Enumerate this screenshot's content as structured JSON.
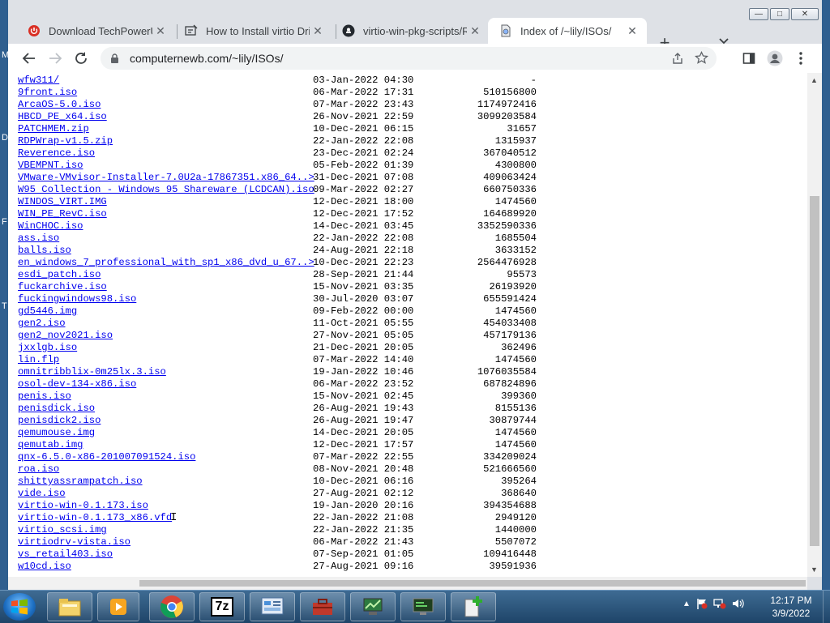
{
  "browser": {
    "tabs": [
      {
        "title": "Download TechPowerUp",
        "icon": "power-icon",
        "active": false
      },
      {
        "title": "How to Install virtio Driv",
        "icon": "site-icon",
        "active": false
      },
      {
        "title": "virtio-win-pkg-scripts/R",
        "icon": "github-icon",
        "active": false
      },
      {
        "title": "Index of /~lily/ISOs/",
        "icon": "file-icon",
        "active": true
      }
    ],
    "close_glyph": "✕",
    "new_tab_glyph": "+",
    "tab_search_glyph": "⌄",
    "url": "computernewb.com/~lily/ISOs/"
  },
  "window_controls": {
    "minimize": "—",
    "maximize": "□",
    "close": "✕"
  },
  "desktop_letters": [
    "M",
    "D",
    "F",
    "T"
  ],
  "listing": [
    {
      "name": "wfw311/",
      "date": "03-Jan-2022 04:30",
      "size": "-"
    },
    {
      "name": "9front.iso",
      "date": "06-Mar-2022 17:31",
      "size": "510156800"
    },
    {
      "name": "ArcaOS-5.0.iso",
      "date": "07-Mar-2022 23:43",
      "size": "1174972416"
    },
    {
      "name": "HBCD_PE_x64.iso",
      "date": "26-Nov-2021 22:59",
      "size": "3099203584"
    },
    {
      "name": "PATCHMEM.zip",
      "date": "10-Dec-2021 06:15",
      "size": "31657"
    },
    {
      "name": "RDPWrap-v1.5.zip",
      "date": "22-Jan-2022 22:08",
      "size": "1315937"
    },
    {
      "name": "Reverence.iso",
      "date": "23-Dec-2021 02:24",
      "size": "367040512"
    },
    {
      "name": "VBEMPNT.iso",
      "date": "05-Feb-2022 01:39",
      "size": "4300800"
    },
    {
      "name": "VMware-VMvisor-Installer-7.0U2a-17867351.x86_64..>",
      "date": "31-Dec-2021 07:08",
      "size": "409063424"
    },
    {
      "name": "W95 Collection - Windows 95 Shareware (LCDCAN).iso",
      "date": "09-Mar-2022 02:27",
      "size": "660750336"
    },
    {
      "name": "WINDOS_VIRT.IMG",
      "date": "12-Dec-2021 18:00",
      "size": "1474560"
    },
    {
      "name": "WIN_PE_RevC.iso",
      "date": "12-Dec-2021 17:52",
      "size": "164689920"
    },
    {
      "name": "WinCHOC.iso",
      "date": "14-Dec-2021 03:45",
      "size": "3352590336"
    },
    {
      "name": "ass.iso",
      "date": "22-Jan-2022 22:08",
      "size": "1685504"
    },
    {
      "name": "balls.iso",
      "date": "24-Aug-2021 22:18",
      "size": "3633152"
    },
    {
      "name": "en_windows_7_professional_with_sp1_x86_dvd_u_67..>",
      "date": "10-Dec-2021 22:23",
      "size": "2564476928"
    },
    {
      "name": "esdi_patch.iso",
      "date": "28-Sep-2021 21:44",
      "size": "95573"
    },
    {
      "name": "fuckarchive.iso",
      "date": "15-Nov-2021 03:35",
      "size": "26193920"
    },
    {
      "name": "fuckingwindows98.iso",
      "date": "30-Jul-2020 03:07",
      "size": "655591424"
    },
    {
      "name": "gd5446.img",
      "date": "09-Feb-2022 00:00",
      "size": "1474560"
    },
    {
      "name": "gen2.iso",
      "date": "11-Oct-2021 05:55",
      "size": "454033408"
    },
    {
      "name": "gen2_nov2021.iso",
      "date": "27-Nov-2021 05:05",
      "size": "457179136"
    },
    {
      "name": "jxxlgb.iso",
      "date": "21-Dec-2021 20:05",
      "size": "362496"
    },
    {
      "name": "lin.flp",
      "date": "07-Mar-2022 14:40",
      "size": "1474560"
    },
    {
      "name": "omnitribblix-0m25lx.3.iso",
      "date": "19-Jan-2022 10:46",
      "size": "1076035584"
    },
    {
      "name": "osol-dev-134-x86.iso",
      "date": "06-Mar-2022 23:52",
      "size": "687824896"
    },
    {
      "name": "penis.iso",
      "date": "15-Nov-2021 02:45",
      "size": "399360"
    },
    {
      "name": "penisdick.iso",
      "date": "26-Aug-2021 19:43",
      "size": "8155136"
    },
    {
      "name": "penisdick2.iso",
      "date": "26-Aug-2021 19:47",
      "size": "30879744"
    },
    {
      "name": "qemumouse.img",
      "date": "14-Dec-2021 20:05",
      "size": "1474560"
    },
    {
      "name": "qemutab.img",
      "date": "12-Dec-2021 17:57",
      "size": "1474560"
    },
    {
      "name": "qnx-6.5.0-x86-201007091524.iso",
      "date": "07-Mar-2022 22:55",
      "size": "334209024"
    },
    {
      "name": "roa.iso",
      "date": "08-Nov-2021 20:48",
      "size": "521666560"
    },
    {
      "name": "shittyassrampatch.iso",
      "date": "10-Dec-2021 06:16",
      "size": "395264"
    },
    {
      "name": "vide.iso",
      "date": "27-Aug-2021 02:12",
      "size": "368640"
    },
    {
      "name": "virtio-win-0.1.173.iso",
      "date": "19-Jan-2020 20:16",
      "size": "394354688"
    },
    {
      "name": "virtio-win-0.1.173_x86.vfd",
      "date": "22-Jan-2022 21:08",
      "size": "2949120"
    },
    {
      "name": "virtio_scsi.img",
      "date": "22-Jan-2022 21:35",
      "size": "1440000"
    },
    {
      "name": "virtiodrv-vista.iso",
      "date": "06-Mar-2022 21:43",
      "size": "5507072"
    },
    {
      "name": "vs_retail403.iso",
      "date": "07-Sep-2021 01:05",
      "size": "109416448"
    },
    {
      "name": "w10cd.iso",
      "date": "27-Aug-2021 09:16",
      "size": "39591936"
    }
  ],
  "taskbar": {
    "items": [
      "explorer-icon",
      "media-player-icon",
      "chrome-icon",
      "7zip-icon",
      "control-panel-icon",
      "toolbox-icon",
      "network-icon",
      "monitor-icon",
      "new-file-icon"
    ],
    "seven_zip_label": "7z",
    "time": "12:17 PM",
    "date": "3/9/2022"
  }
}
